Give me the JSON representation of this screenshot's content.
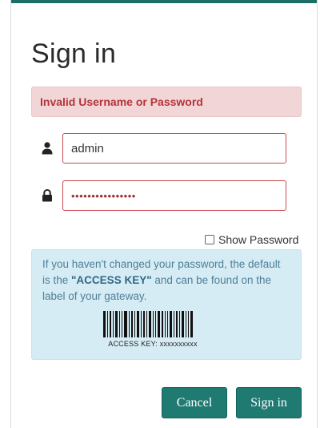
{
  "title": "Sign in",
  "alert": {
    "message": "Invalid Username or Password",
    "color": "#b3343a"
  },
  "username": {
    "icon": "user-icon",
    "value": "admin"
  },
  "password": {
    "icon": "lock-icon",
    "value": "••••••••••••••••"
  },
  "show_password": {
    "label": "Show Password",
    "checked": false
  },
  "info": {
    "text_before": "If you haven't changed your password, the default is the ",
    "emphasis": "\"ACCESS KEY\"",
    "text_after": " and can be found on the label of your gateway.",
    "barcode_caption": "ACCESS KEY: xxxxxxxxxx"
  },
  "buttons": {
    "cancel": "Cancel",
    "signin": "Sign in"
  },
  "colors": {
    "accent": "#1f7a71",
    "alert_bg": "#f2d6d7",
    "info_bg": "#d6ecf5"
  }
}
